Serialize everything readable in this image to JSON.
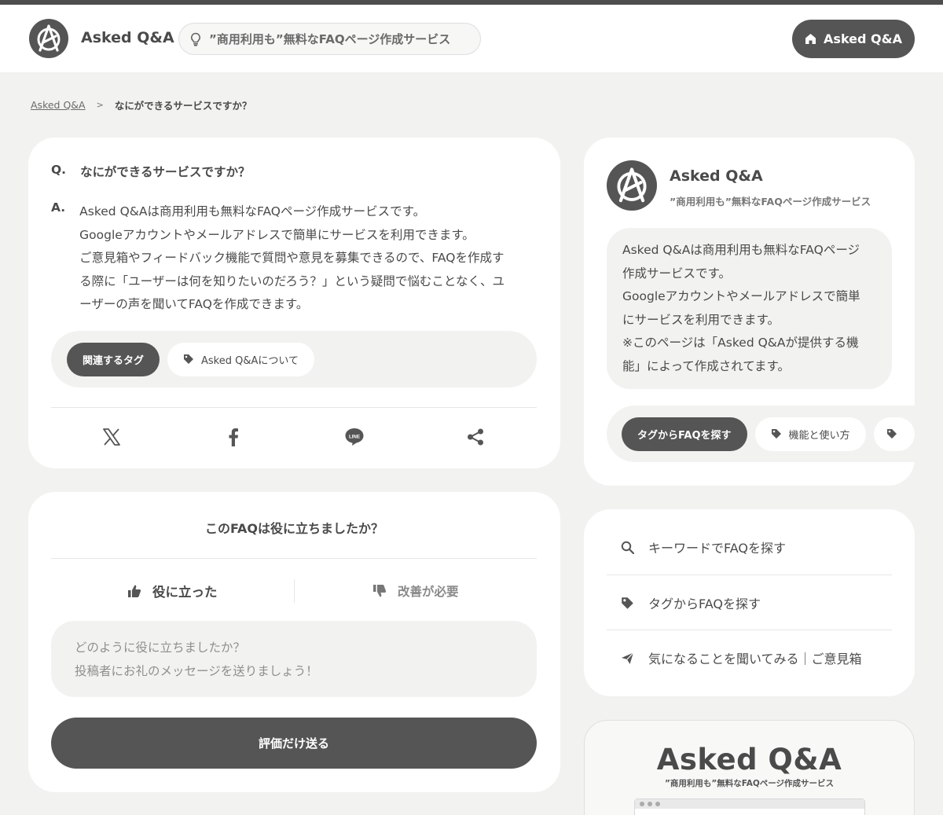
{
  "header": {
    "brand": "Asked Q&A",
    "tagline": "”商用利用も”無料なFAQページ作成サービス",
    "home_button": "Asked Q&A"
  },
  "breadcrumb": {
    "root": "Asked Q&A",
    "separator": ">",
    "current": "なにができるサービスですか？"
  },
  "qa": {
    "q_mark": "Q.",
    "question": "なにができるサービスですか？",
    "a_mark": "A.",
    "answer_lines": [
      "Asked Q&Aは商用利用も無料なFAQページ作成サービスです。",
      "Googleアカウントやメールアドレスで簡単にサービスを利用できます。",
      "ご意見箱やフィードバック機能で質問や意見を募集できるので、FAQを作成す",
      "る際に「ユーザーは何を知りたいのだろう？」という疑問で悩むことなく、ユ",
      "ーザーの声を聞いてFAQを作成できます。"
    ],
    "related_tags_label": "関連するタグ",
    "tag": "Asked Q&Aについて"
  },
  "feedback": {
    "title": "このFAQは役に立ちましたか？",
    "good": "役に立った",
    "bad": "改善が必要",
    "placeholder_lines": [
      "どのように役に立ちましたか？",
      "投稿者にお礼のメッセージを送りましょう！"
    ],
    "submit": "評価だけ送る"
  },
  "profile": {
    "name": "Asked Q&A",
    "tagline": "”商用利用も”無料なFAQページ作成サービス",
    "description_lines": [
      "Asked Q&Aは商用利用も無料なFAQページ",
      "作成サービスです。",
      "Googleアカウントやメールアドレスで簡単",
      "にサービスを利用できます。",
      "※このページは「Asked Q&Aが提供する機",
      "能」によって作成されてます。"
    ],
    "tag_search_label": "タグからFAQを探す",
    "tags": [
      "機能と使い方"
    ]
  },
  "links": [
    {
      "label": "キーワードでFAQを探す",
      "icon": "search-icon"
    },
    {
      "label": "タグからFAQを探す",
      "icon": "tag-icon"
    },
    {
      "label": "気になることを聞いてみる｜ご意見箱",
      "icon": "send-icon"
    }
  ],
  "promo": {
    "title": "Asked Q&A",
    "subtitle": "”商用利用も”無料なFAQページ作成サービス"
  },
  "colors": {
    "dark": "#555555",
    "background": "#f2f2f0",
    "card": "#ffffff"
  }
}
